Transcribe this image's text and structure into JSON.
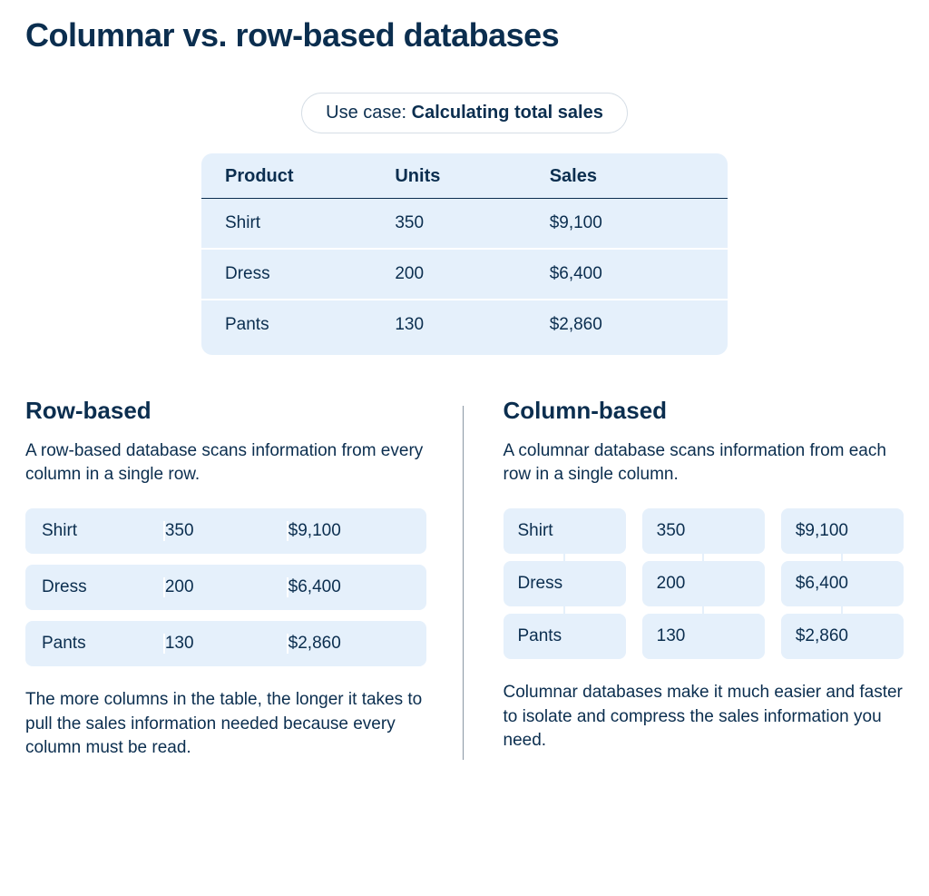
{
  "title": "Columnar vs. row-based databases",
  "usecase": {
    "prefix": "Use case: ",
    "value": "Calculating total sales"
  },
  "table": {
    "headers": {
      "product": "Product",
      "units": "Units",
      "sales": "Sales"
    },
    "rows": [
      {
        "product": "Shirt",
        "units": "350",
        "sales": "$9,100"
      },
      {
        "product": "Dress",
        "units": "200",
        "sales": "$6,400"
      },
      {
        "product": "Pants",
        "units": "130",
        "sales": "$2,860"
      }
    ]
  },
  "row_based": {
    "heading": "Row-based",
    "lead": "A row-based database scans information from every column in a single row.",
    "rows": [
      {
        "product": "Shirt",
        "units": "350",
        "sales": "$9,100"
      },
      {
        "product": "Dress",
        "units": "200",
        "sales": "$6,400"
      },
      {
        "product": "Pants",
        "units": "130",
        "sales": "$2,860"
      }
    ],
    "tail": "The more columns in the table, the longer it takes to pull the sales information needed because every column must be read."
  },
  "column_based": {
    "heading": "Column-based",
    "lead": "A columnar database scans information from each row in a single column.",
    "columns": {
      "product": [
        "Shirt",
        "Dress",
        "Pants"
      ],
      "units": [
        "350",
        "200",
        "130"
      ],
      "sales": [
        "$9,100",
        "$6,400",
        "$2,860"
      ]
    },
    "tail": "Columnar databases make it much easier and faster to isolate and compress the sales information you need."
  }
}
